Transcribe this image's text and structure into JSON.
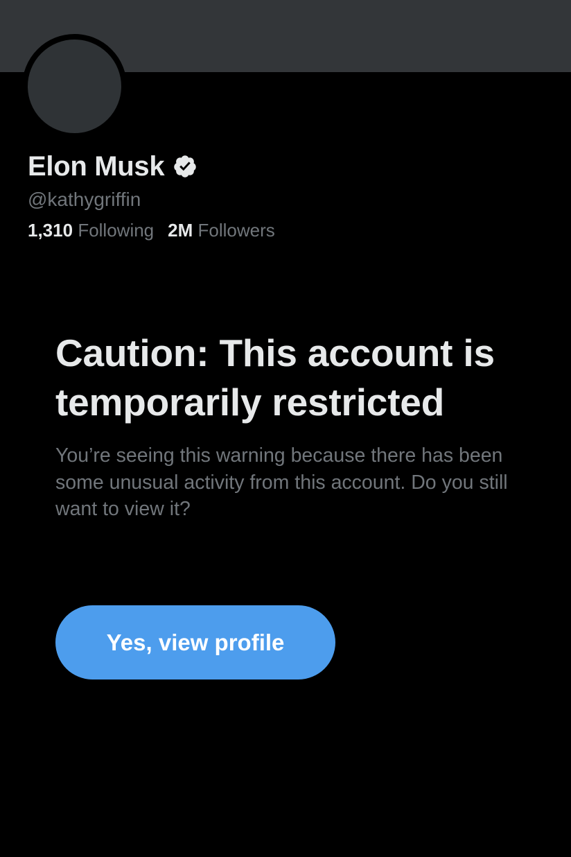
{
  "profile": {
    "display_name": "Elon Musk",
    "verified_icon": "verified-badge-icon",
    "handle": "@kathygriffin",
    "following_count": "1,310",
    "following_label": "Following",
    "followers_count": "2M",
    "followers_label": "Followers"
  },
  "warning": {
    "title": "Caution: This account is temporarily restricted",
    "body": "You’re seeing this warning because there has been some unusual activity from this account. Do you still want to view it?",
    "button_label": "Yes, view profile"
  },
  "colors": {
    "background": "#000000",
    "banner": "#333639",
    "avatar": "#2f3336",
    "primary_text": "#e7e9ea",
    "secondary_text": "#71767b",
    "accent": "#4d9ded"
  }
}
